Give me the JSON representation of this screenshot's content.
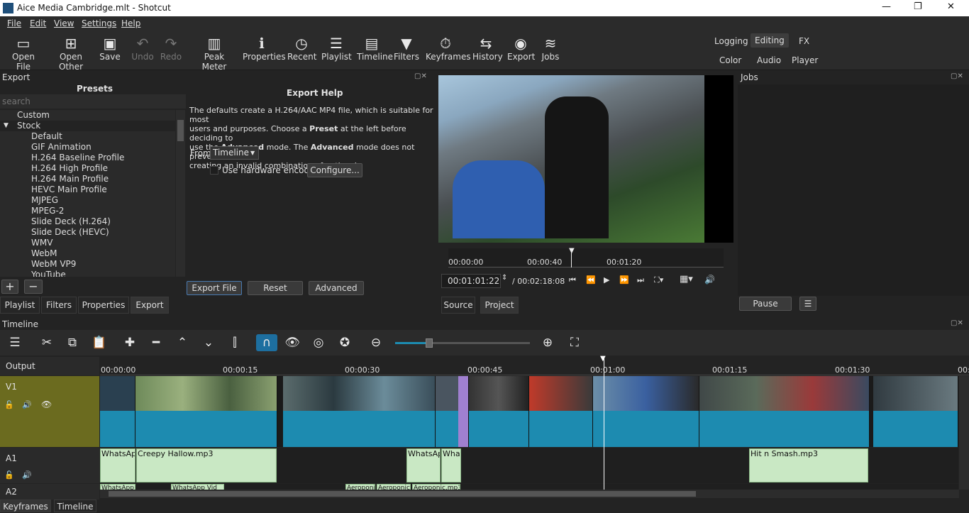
{
  "window": {
    "title": "Aice Media Cambridge.mlt - Shotcut",
    "min": "—",
    "max": "❐",
    "close": "✕"
  },
  "menu": [
    "File",
    "Edit",
    "View",
    "Settings",
    "Help"
  ],
  "toolbar": {
    "open_file": "Open File",
    "open_other": "Open Other",
    "save": "Save",
    "undo": "Undo",
    "redo": "Redo",
    "peak_meter": "Peak Meter",
    "properties": "Properties",
    "recent": "Recent",
    "playlist": "Playlist",
    "timeline": "Timeline",
    "filters": "Filters",
    "keyframes": "Keyframes",
    "history": "History",
    "export": "Export",
    "jobs": "Jobs"
  },
  "layouts": {
    "logging": "Logging",
    "editing": "Editing",
    "fx": "FX",
    "color": "Color",
    "audio": "Audio",
    "player": "Player"
  },
  "export_panel": {
    "title": "Export",
    "presets_title": "Presets",
    "search_placeholder": "search",
    "presets": [
      "Custom",
      "Stock",
      "Default",
      "GIF Animation",
      "H.264 Baseline Profile",
      "H.264 High Profile",
      "H.264 Main Profile",
      "HEVC Main Profile",
      "MJPEG",
      "MPEG-2",
      "Slide Deck (H.264)",
      "Slide Deck (HEVC)",
      "WMV",
      "WebM",
      "WebM VP9",
      "YouTube"
    ],
    "help_title": "Export Help",
    "help_l1": "The defaults create a H.264/AAC MP4 file, which is suitable for most",
    "help_l2": "users and purposes. Choose a ",
    "help_preset": "Preset",
    "help_l2b": " at the left before deciding to",
    "help_l3": "use the ",
    "help_adv": "Advanced",
    "help_l3b": " mode. The ",
    "help_adv2": "Advanced",
    "help_l3c": " mode does not prevent",
    "help_l4": "creating an invalid combination of options!",
    "from_label": "From",
    "from_value": "Timeline",
    "hw_label": "Use hardware encoder",
    "configure": "Configure...",
    "export_file": "Export File",
    "reset": "Reset",
    "advanced": "Advanced",
    "add": "+",
    "remove": "−"
  },
  "left_tabs": [
    "Playlist",
    "Filters",
    "Properties",
    "Export"
  ],
  "player": {
    "t0": "00:00:00",
    "t1": "00:00:40",
    "t2": "00:01:20",
    "timecode": "00:01:01:22",
    "duration": "/ 00:02:18:08",
    "tab_source": "Source",
    "tab_project": "Project"
  },
  "jobs": {
    "title": "Jobs",
    "pause": "Pause",
    "menu": "☰"
  },
  "timeline": {
    "title": "Timeline",
    "ruler": [
      "00:00:00",
      "00:00:15",
      "00:00:30",
      "00:00:45",
      "00:01:00",
      "00:01:15",
      "00:01:30",
      "00:0"
    ],
    "tracks": {
      "output": "Output",
      "v1": "V1",
      "a1": "A1",
      "a2": "A2"
    },
    "a1_clips": [
      "WhatsApp",
      "Creepy Hallow.mp3",
      "WhatsApp",
      "Whats",
      "Hit n Smash.mp3"
    ],
    "a2_clips": [
      "WhatsApp",
      "WhatsApp Vid",
      "Aeroponic",
      "Aeroponic",
      "Aeroponic.mp3"
    ]
  },
  "bottom_tabs": [
    "Keyframes",
    "Timeline"
  ],
  "colors": {
    "accent": "#1d8bb0",
    "v1_header": "#6b6b1f",
    "audio_clip": "#c9e8c4"
  }
}
